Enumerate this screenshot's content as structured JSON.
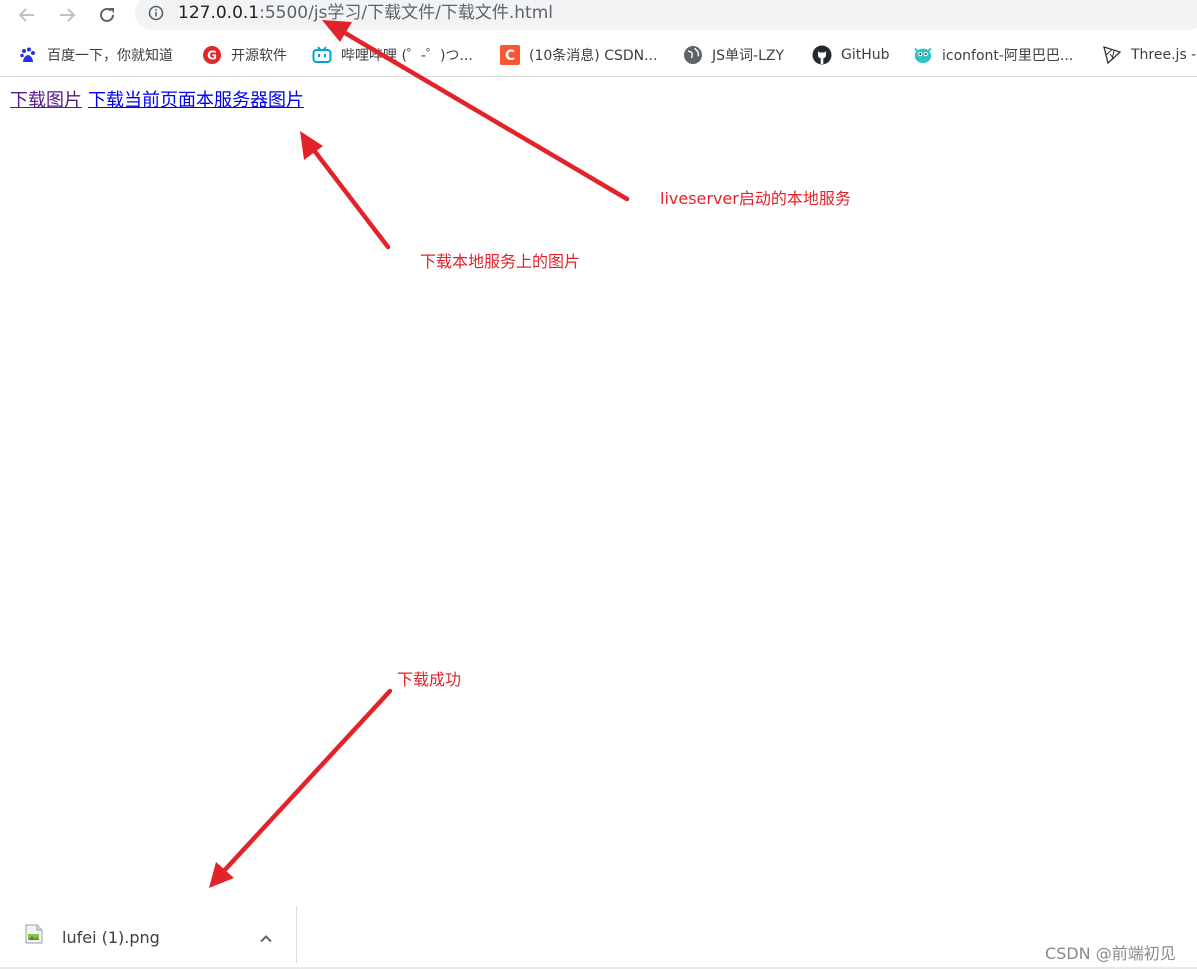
{
  "address_bar": {
    "url_host": "127.0.0.1",
    "url_rest": ":5500/js学习/下载文件/下载文件.html"
  },
  "bookmarks": [
    {
      "label": "百度一下，你就知道",
      "icon": "baidu-icon"
    },
    {
      "label": "开源软件",
      "icon": "oschina-icon"
    },
    {
      "label": "哔哩哔哩 (゜-゜)つ...",
      "icon": "bilibili-icon"
    },
    {
      "label": "(10条消息) CSDN...",
      "icon": "csdn-icon"
    },
    {
      "label": "JS单词-LZY",
      "icon": "globe-icon"
    },
    {
      "label": "GitHub",
      "icon": "github-icon"
    },
    {
      "label": "iconfont-阿里巴巴...",
      "icon": "iconfont-icon"
    },
    {
      "label": "Three.js -",
      "icon": "threejs-icon"
    }
  ],
  "page": {
    "link_download_image": "下载图片",
    "link_download_server_image": "下载当前页面本服务器图片"
  },
  "annotations": {
    "liveserver": "liveserver启动的本地服务",
    "local_download": "下载本地服务上的图片",
    "success": "下载成功"
  },
  "download_shelf": {
    "file_name": "lufei (1).png"
  },
  "watermark": "CSDN @前端初见",
  "colors": {
    "annotation_red": "#e2232a",
    "link_blue": "#0000ee",
    "link_visited": "#551a8b"
  }
}
